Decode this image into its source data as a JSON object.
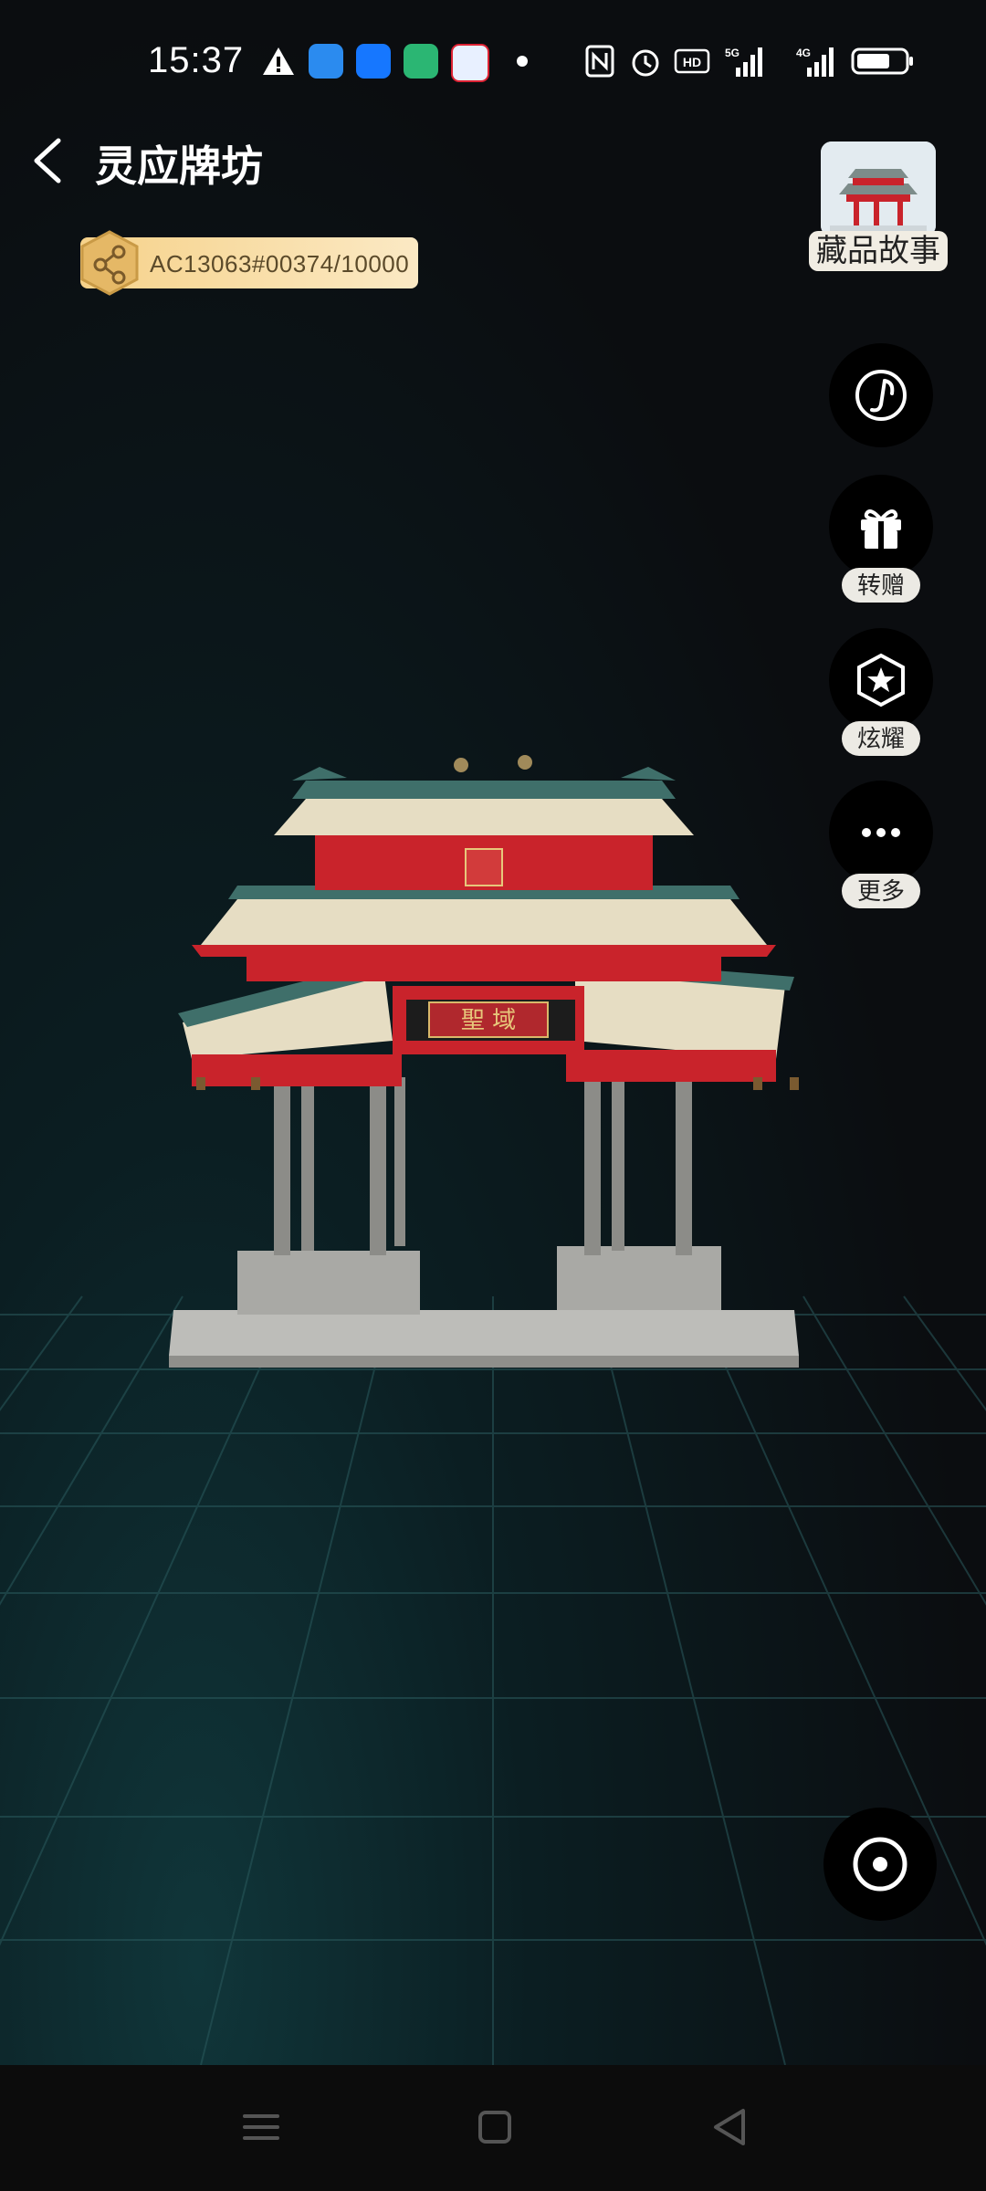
{
  "status_bar": {
    "time": "15:37",
    "icons": [
      "warning-icon",
      "app-blue-icon",
      "alipay-icon",
      "app-green-icon",
      "baidu-icon",
      "dot-icon",
      "nfc-icon",
      "alarm-icon",
      "hd-icon",
      "signal-5g-icon",
      "signal-4g-icon",
      "battery-icon"
    ],
    "battery_level": 0.7
  },
  "header": {
    "title": "灵应牌坊"
  },
  "serial": {
    "text": "AC13063#00374/10000"
  },
  "story": {
    "label": "藏品故事"
  },
  "actions": [
    {
      "id": "music",
      "icon": "music-icon",
      "label": ""
    },
    {
      "id": "gift",
      "icon": "gift-icon",
      "label": "转赠"
    },
    {
      "id": "showcase",
      "icon": "badge-star-icon",
      "label": "炫耀"
    },
    {
      "id": "more",
      "icon": "more-icon",
      "label": "更多"
    }
  ],
  "model": {
    "plaque_text": "聖 域"
  },
  "colors": {
    "background": "#0c0d0f",
    "accent_gold": "#f6d28a",
    "roof_red": "#c9232b",
    "roof_tile": "#e6ddc3",
    "grid_teal": "#1f5b5e"
  }
}
